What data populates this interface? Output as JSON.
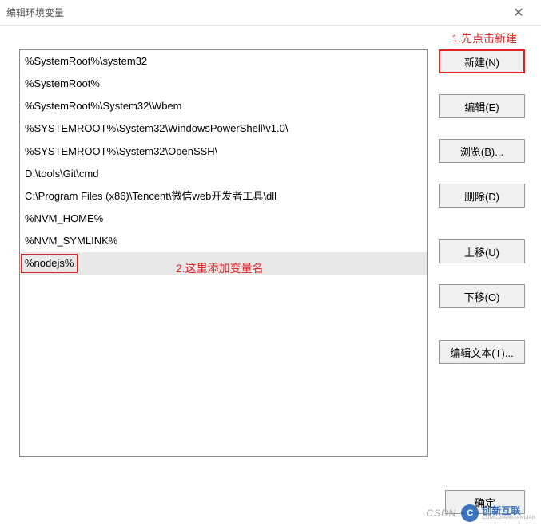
{
  "titlebar": {
    "title": "编辑环境变量",
    "close_glyph": "✕"
  },
  "path_list": {
    "items": [
      "%SystemRoot%\\system32",
      "%SystemRoot%",
      "%SystemRoot%\\System32\\Wbem",
      "%SYSTEMROOT%\\System32\\WindowsPowerShell\\v1.0\\",
      "%SYSTEMROOT%\\System32\\OpenSSH\\",
      "D:\\tools\\Git\\cmd",
      "C:\\Program Files (x86)\\Tencent\\微信web开发者工具\\dll",
      "%NVM_HOME%",
      "%NVM_SYMLINK%",
      "%nodejs%"
    ],
    "selected_index": 9
  },
  "buttons": {
    "new": "新建(N)",
    "edit": "编辑(E)",
    "browse": "浏览(B)...",
    "delete": "删除(D)",
    "move_up": "上移(U)",
    "move_down": "下移(O)",
    "edit_text": "编辑文本(T)...",
    "ok": "确定",
    "cancel": ""
  },
  "annotations": {
    "a1": "1.先点击新建",
    "a2": "2.这里添加变量名"
  },
  "watermark": {
    "csdn": "CSDN",
    "logo_letter": "C",
    "brand_cn": "创新互联",
    "brand_en": "CDMCDIANXIANLIAN"
  }
}
